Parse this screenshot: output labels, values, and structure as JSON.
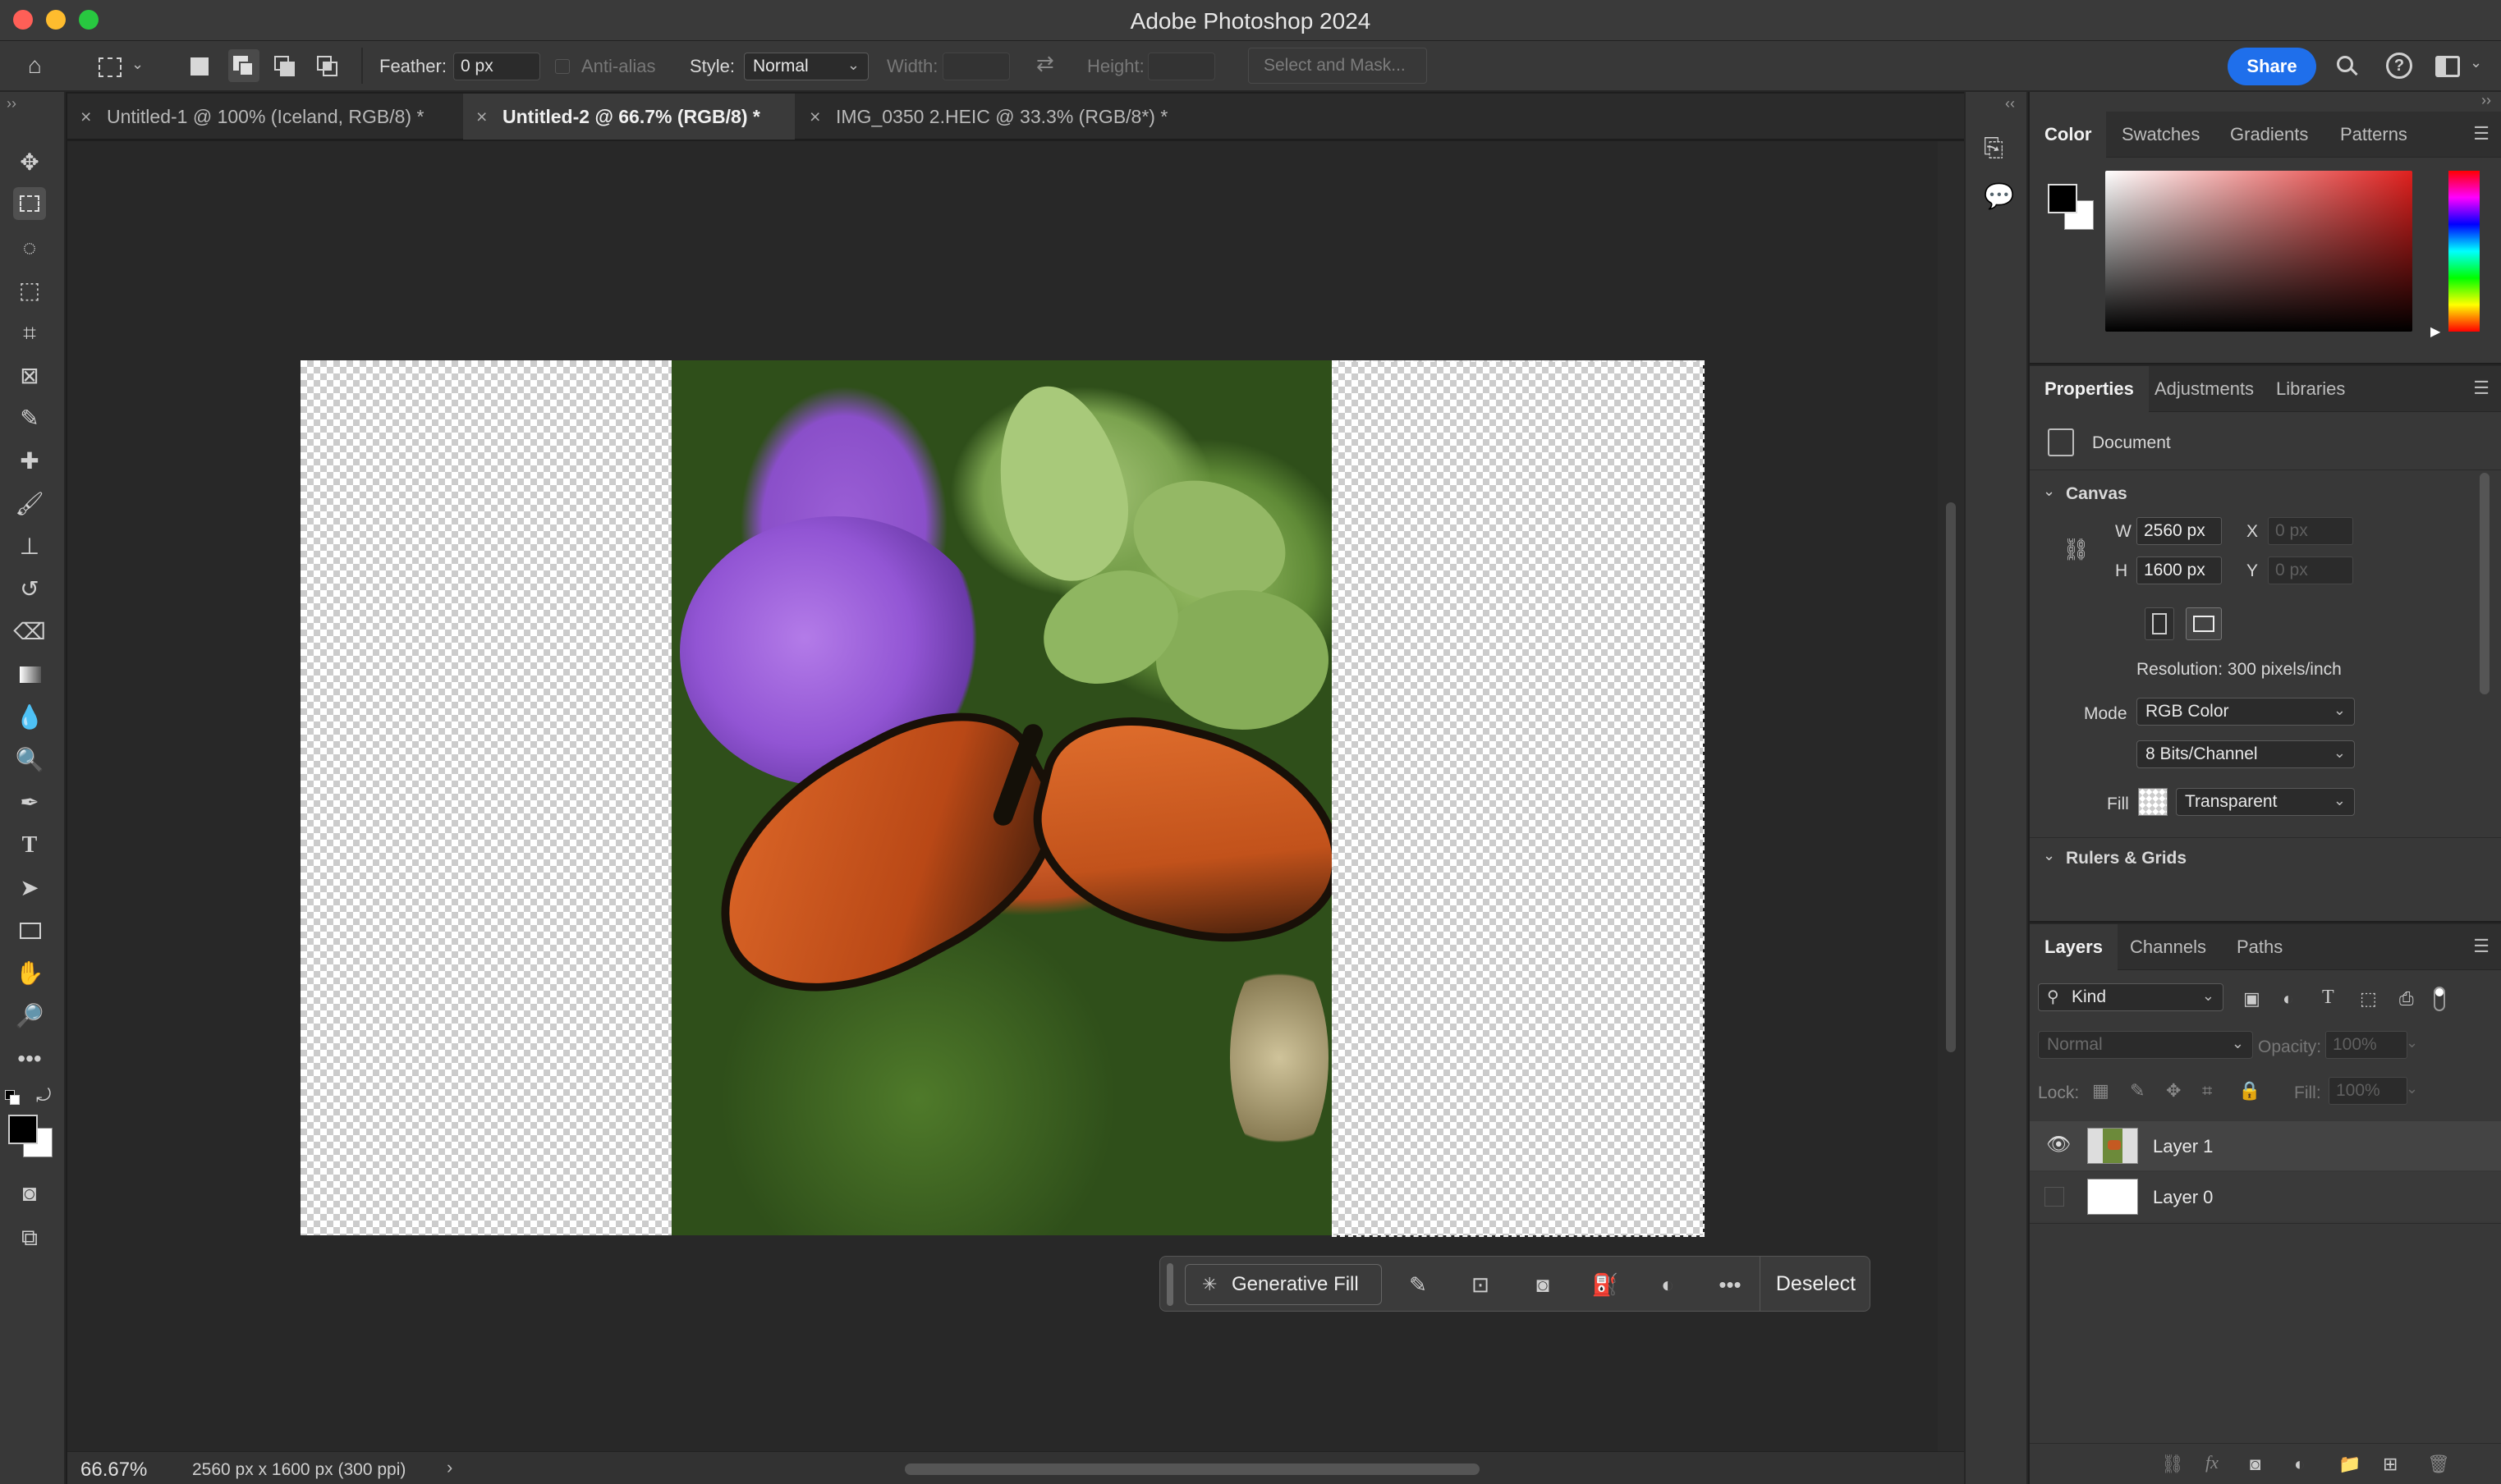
{
  "app": {
    "window_title": "Adobe Photoshop 2024"
  },
  "options_bar": {
    "feather_label": "Feather:",
    "feather_value": "0 px",
    "antialias_label": "Anti-alias",
    "style_label": "Style:",
    "style_value": "Normal",
    "width_label": "Width:",
    "height_label": "Height:",
    "select_mask_label": "Select and Mask...",
    "share_label": "Share"
  },
  "tabs": [
    {
      "label": "Untitled-1 @ 100% (Iceland, RGB/8) *",
      "active": false
    },
    {
      "label": "Untitled-2 @ 66.7% (RGB/8) *",
      "active": true
    },
    {
      "label": "IMG_0350 2.HEIC @ 33.3% (RGB/8*) *",
      "active": false
    }
  ],
  "contextual_taskbar": {
    "generative_fill_label": "Generative Fill",
    "deselect_label": "Deselect"
  },
  "status_bar": {
    "zoom": "66.67%",
    "doc_info": "2560 px x 1600 px (300 ppi)"
  },
  "color_panel": {
    "tabs": [
      "Color",
      "Swatches",
      "Gradients",
      "Patterns"
    ],
    "foreground": "#000000",
    "background": "#ffffff"
  },
  "properties_panel": {
    "tabs": [
      "Properties",
      "Adjustments",
      "Libraries"
    ],
    "type_label": "Document",
    "canvas_section": "Canvas",
    "w_label": "W",
    "w_value": "2560 px",
    "h_label": "H",
    "h_value": "1600 px",
    "x_label": "X",
    "x_placeholder": "0 px",
    "y_label": "Y",
    "y_placeholder": "0 px",
    "resolution": "Resolution: 300 pixels/inch",
    "mode_label": "Mode",
    "mode_value": "RGB Color",
    "bits_value": "8 Bits/Channel",
    "fill_label": "Fill",
    "fill_value": "Transparent",
    "rulers_section": "Rulers & Grids"
  },
  "layers_panel": {
    "tabs": [
      "Layers",
      "Channels",
      "Paths"
    ],
    "filter_value": "Kind",
    "blend_mode": "Normal",
    "opacity_label": "Opacity:",
    "opacity_value": "100%",
    "lock_label": "Lock:",
    "fill_label": "Fill:",
    "fill_value": "100%",
    "layers": [
      {
        "name": "Layer 1",
        "visible": true
      },
      {
        "name": "Layer 0",
        "visible": false
      }
    ]
  }
}
